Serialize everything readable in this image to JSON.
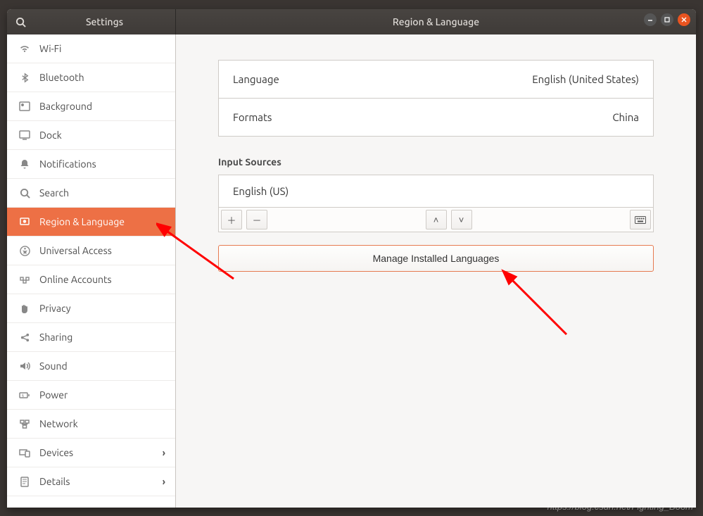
{
  "sidebar": {
    "title": "Settings",
    "items": [
      {
        "label": "Wi-Fi",
        "icon": "wifi"
      },
      {
        "label": "Bluetooth",
        "icon": "bluetooth"
      },
      {
        "label": "Background",
        "icon": "background"
      },
      {
        "label": "Dock",
        "icon": "dock"
      },
      {
        "label": "Notifications",
        "icon": "bell"
      },
      {
        "label": "Search",
        "icon": "search"
      },
      {
        "label": "Region & Language",
        "icon": "flag"
      },
      {
        "label": "Universal Access",
        "icon": "accessibility"
      },
      {
        "label": "Online Accounts",
        "icon": "cloud"
      },
      {
        "label": "Privacy",
        "icon": "hand"
      },
      {
        "label": "Sharing",
        "icon": "share"
      },
      {
        "label": "Sound",
        "icon": "sound"
      },
      {
        "label": "Power",
        "icon": "power"
      },
      {
        "label": "Network",
        "icon": "network"
      },
      {
        "label": "Devices",
        "icon": "devices",
        "chevron": true
      },
      {
        "label": "Details",
        "icon": "details",
        "chevron": true
      }
    ],
    "active_index": 6
  },
  "header": {
    "title": "Region & Language"
  },
  "main": {
    "language_row": {
      "label": "Language",
      "value": "English (United States)"
    },
    "formats_row": {
      "label": "Formats",
      "value": "China"
    },
    "input_sources_label": "Input Sources",
    "input_sources": [
      {
        "name": "English (US)"
      }
    ],
    "manage_button": "Manage Installed Languages"
  },
  "watermark": "https://blog.csdn.net/Fighting_Boom"
}
